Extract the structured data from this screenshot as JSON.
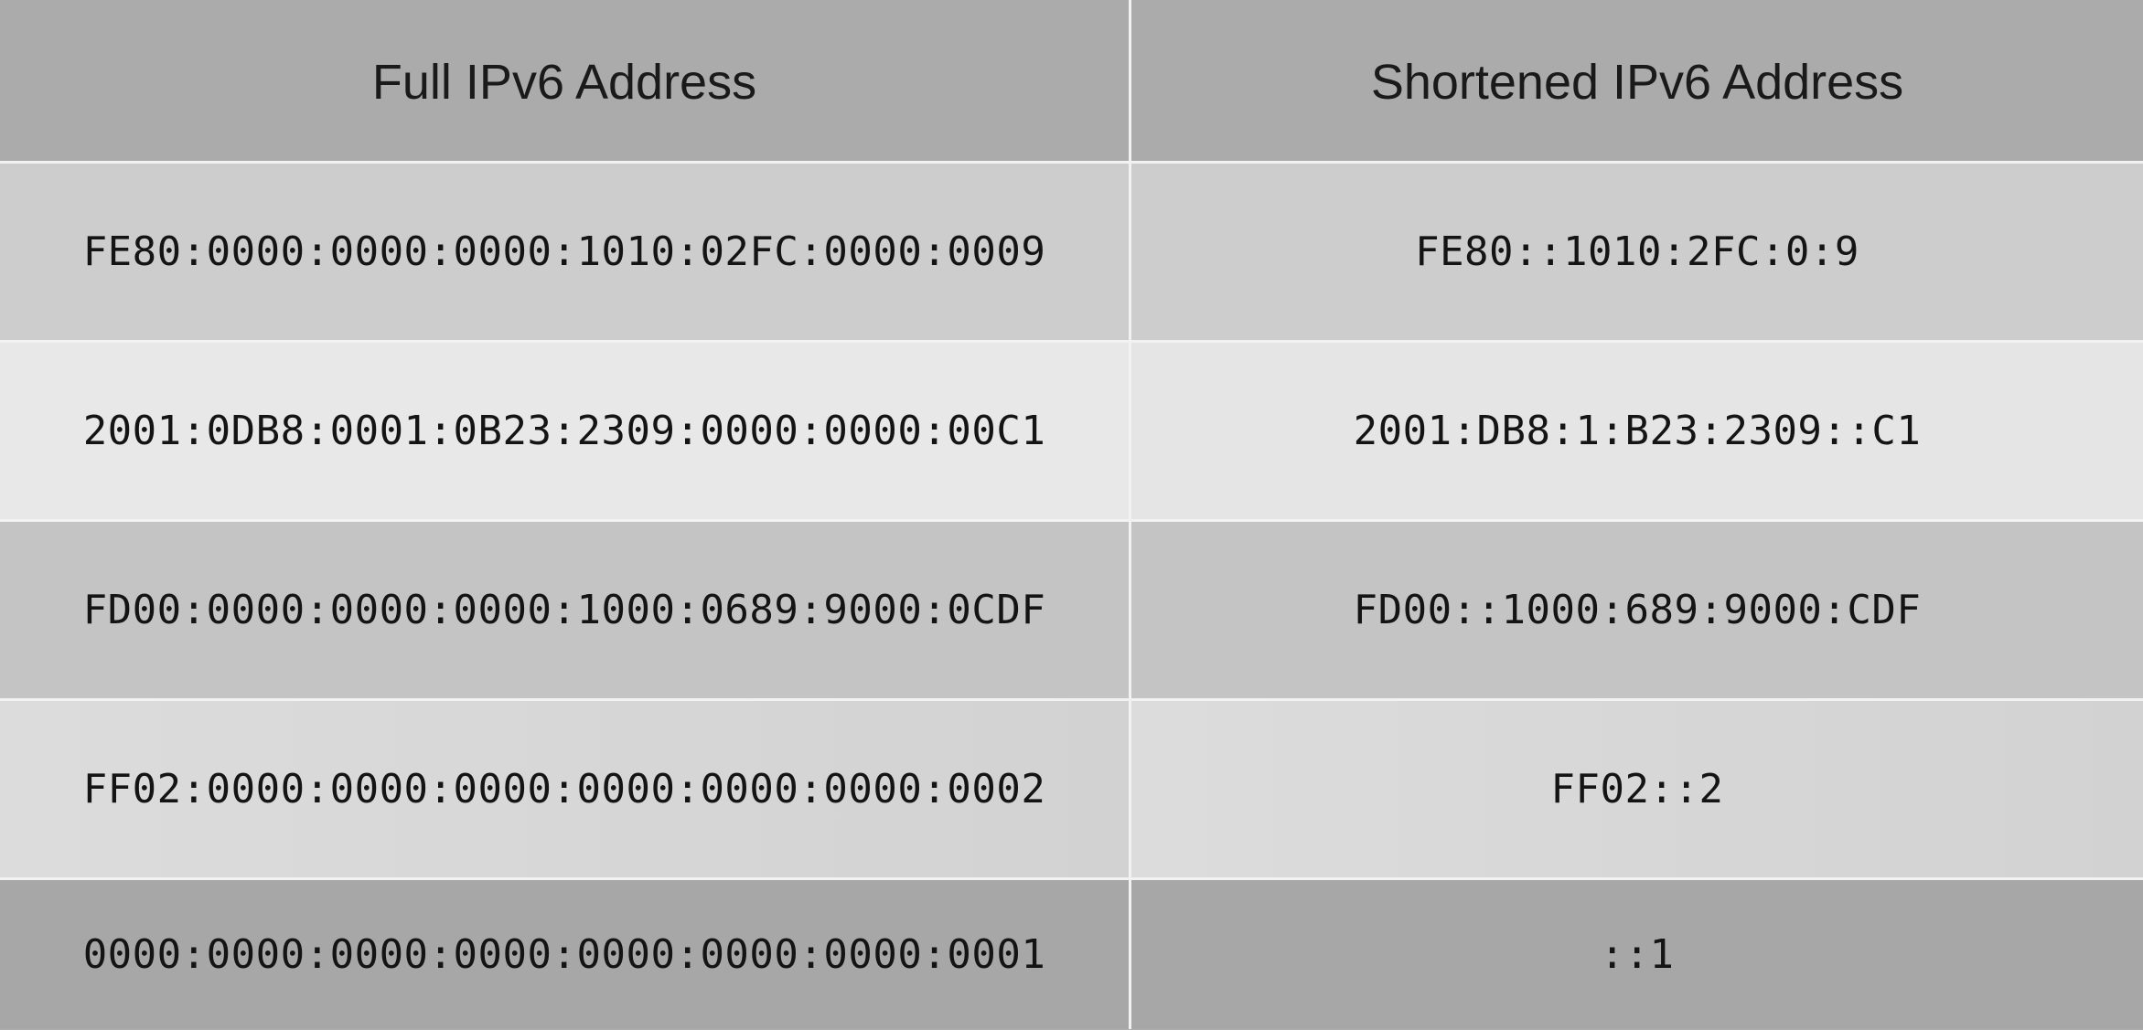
{
  "table": {
    "headers": [
      "Full IPv6 Address",
      "Shortened IPv6 Address"
    ],
    "rows": [
      {
        "full": "FE80:0000:0000:0000:1010:02FC:0000:0009",
        "short": "FE80::1010:2FC:0:9"
      },
      {
        "full": "2001:0DB8:0001:0B23:2309:0000:0000:00C1",
        "short": "2001:DB8:1:B23:2309::C1"
      },
      {
        "full": "FD00:0000:0000:0000:1000:0689:9000:0CDF",
        "short": "FD00::1000:689:9000:CDF"
      },
      {
        "full": "FF02:0000:0000:0000:0000:0000:0000:0002",
        "short": "FF02::2"
      },
      {
        "full": "0000:0000:0000:0000:0000:0000:0000:0001",
        "short": "::1"
      }
    ]
  }
}
